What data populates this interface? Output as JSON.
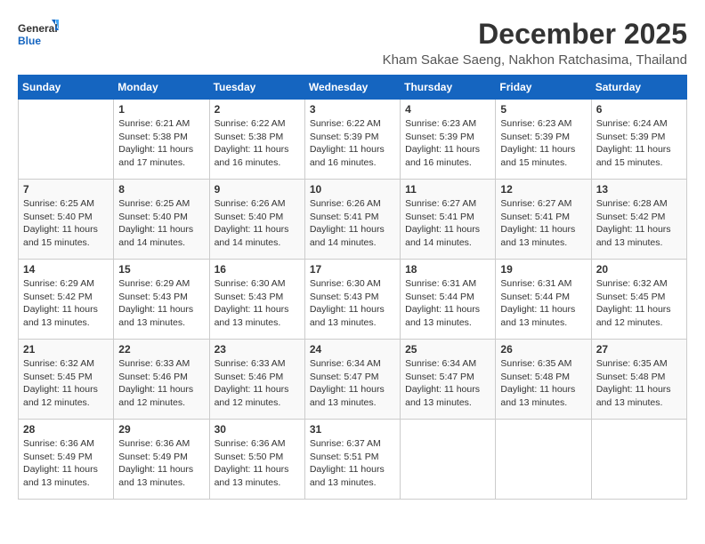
{
  "header": {
    "logo_line1": "General",
    "logo_line2": "Blue",
    "month_title": "December 2025",
    "location": "Kham Sakae Saeng, Nakhon Ratchasima, Thailand"
  },
  "days_of_week": [
    "Sunday",
    "Monday",
    "Tuesday",
    "Wednesday",
    "Thursday",
    "Friday",
    "Saturday"
  ],
  "weeks": [
    [
      {
        "day": "",
        "sunrise": "",
        "sunset": "",
        "daylight": ""
      },
      {
        "day": "1",
        "sunrise": "Sunrise: 6:21 AM",
        "sunset": "Sunset: 5:38 PM",
        "daylight": "Daylight: 11 hours and 17 minutes."
      },
      {
        "day": "2",
        "sunrise": "Sunrise: 6:22 AM",
        "sunset": "Sunset: 5:38 PM",
        "daylight": "Daylight: 11 hours and 16 minutes."
      },
      {
        "day": "3",
        "sunrise": "Sunrise: 6:22 AM",
        "sunset": "Sunset: 5:39 PM",
        "daylight": "Daylight: 11 hours and 16 minutes."
      },
      {
        "day": "4",
        "sunrise": "Sunrise: 6:23 AM",
        "sunset": "Sunset: 5:39 PM",
        "daylight": "Daylight: 11 hours and 16 minutes."
      },
      {
        "day": "5",
        "sunrise": "Sunrise: 6:23 AM",
        "sunset": "Sunset: 5:39 PM",
        "daylight": "Daylight: 11 hours and 15 minutes."
      },
      {
        "day": "6",
        "sunrise": "Sunrise: 6:24 AM",
        "sunset": "Sunset: 5:39 PM",
        "daylight": "Daylight: 11 hours and 15 minutes."
      }
    ],
    [
      {
        "day": "7",
        "sunrise": "Sunrise: 6:25 AM",
        "sunset": "Sunset: 5:40 PM",
        "daylight": "Daylight: 11 hours and 15 minutes."
      },
      {
        "day": "8",
        "sunrise": "Sunrise: 6:25 AM",
        "sunset": "Sunset: 5:40 PM",
        "daylight": "Daylight: 11 hours and 14 minutes."
      },
      {
        "day": "9",
        "sunrise": "Sunrise: 6:26 AM",
        "sunset": "Sunset: 5:40 PM",
        "daylight": "Daylight: 11 hours and 14 minutes."
      },
      {
        "day": "10",
        "sunrise": "Sunrise: 6:26 AM",
        "sunset": "Sunset: 5:41 PM",
        "daylight": "Daylight: 11 hours and 14 minutes."
      },
      {
        "day": "11",
        "sunrise": "Sunrise: 6:27 AM",
        "sunset": "Sunset: 5:41 PM",
        "daylight": "Daylight: 11 hours and 14 minutes."
      },
      {
        "day": "12",
        "sunrise": "Sunrise: 6:27 AM",
        "sunset": "Sunset: 5:41 PM",
        "daylight": "Daylight: 11 hours and 13 minutes."
      },
      {
        "day": "13",
        "sunrise": "Sunrise: 6:28 AM",
        "sunset": "Sunset: 5:42 PM",
        "daylight": "Daylight: 11 hours and 13 minutes."
      }
    ],
    [
      {
        "day": "14",
        "sunrise": "Sunrise: 6:29 AM",
        "sunset": "Sunset: 5:42 PM",
        "daylight": "Daylight: 11 hours and 13 minutes."
      },
      {
        "day": "15",
        "sunrise": "Sunrise: 6:29 AM",
        "sunset": "Sunset: 5:43 PM",
        "daylight": "Daylight: 11 hours and 13 minutes."
      },
      {
        "day": "16",
        "sunrise": "Sunrise: 6:30 AM",
        "sunset": "Sunset: 5:43 PM",
        "daylight": "Daylight: 11 hours and 13 minutes."
      },
      {
        "day": "17",
        "sunrise": "Sunrise: 6:30 AM",
        "sunset": "Sunset: 5:43 PM",
        "daylight": "Daylight: 11 hours and 13 minutes."
      },
      {
        "day": "18",
        "sunrise": "Sunrise: 6:31 AM",
        "sunset": "Sunset: 5:44 PM",
        "daylight": "Daylight: 11 hours and 13 minutes."
      },
      {
        "day": "19",
        "sunrise": "Sunrise: 6:31 AM",
        "sunset": "Sunset: 5:44 PM",
        "daylight": "Daylight: 11 hours and 13 minutes."
      },
      {
        "day": "20",
        "sunrise": "Sunrise: 6:32 AM",
        "sunset": "Sunset: 5:45 PM",
        "daylight": "Daylight: 11 hours and 12 minutes."
      }
    ],
    [
      {
        "day": "21",
        "sunrise": "Sunrise: 6:32 AM",
        "sunset": "Sunset: 5:45 PM",
        "daylight": "Daylight: 11 hours and 12 minutes."
      },
      {
        "day": "22",
        "sunrise": "Sunrise: 6:33 AM",
        "sunset": "Sunset: 5:46 PM",
        "daylight": "Daylight: 11 hours and 12 minutes."
      },
      {
        "day": "23",
        "sunrise": "Sunrise: 6:33 AM",
        "sunset": "Sunset: 5:46 PM",
        "daylight": "Daylight: 11 hours and 12 minutes."
      },
      {
        "day": "24",
        "sunrise": "Sunrise: 6:34 AM",
        "sunset": "Sunset: 5:47 PM",
        "daylight": "Daylight: 11 hours and 13 minutes."
      },
      {
        "day": "25",
        "sunrise": "Sunrise: 6:34 AM",
        "sunset": "Sunset: 5:47 PM",
        "daylight": "Daylight: 11 hours and 13 minutes."
      },
      {
        "day": "26",
        "sunrise": "Sunrise: 6:35 AM",
        "sunset": "Sunset: 5:48 PM",
        "daylight": "Daylight: 11 hours and 13 minutes."
      },
      {
        "day": "27",
        "sunrise": "Sunrise: 6:35 AM",
        "sunset": "Sunset: 5:48 PM",
        "daylight": "Daylight: 11 hours and 13 minutes."
      }
    ],
    [
      {
        "day": "28",
        "sunrise": "Sunrise: 6:36 AM",
        "sunset": "Sunset: 5:49 PM",
        "daylight": "Daylight: 11 hours and 13 minutes."
      },
      {
        "day": "29",
        "sunrise": "Sunrise: 6:36 AM",
        "sunset": "Sunset: 5:49 PM",
        "daylight": "Daylight: 11 hours and 13 minutes."
      },
      {
        "day": "30",
        "sunrise": "Sunrise: 6:36 AM",
        "sunset": "Sunset: 5:50 PM",
        "daylight": "Daylight: 11 hours and 13 minutes."
      },
      {
        "day": "31",
        "sunrise": "Sunrise: 6:37 AM",
        "sunset": "Sunset: 5:51 PM",
        "daylight": "Daylight: 11 hours and 13 minutes."
      },
      {
        "day": "",
        "sunrise": "",
        "sunset": "",
        "daylight": ""
      },
      {
        "day": "",
        "sunrise": "",
        "sunset": "",
        "daylight": ""
      },
      {
        "day": "",
        "sunrise": "",
        "sunset": "",
        "daylight": ""
      }
    ]
  ]
}
